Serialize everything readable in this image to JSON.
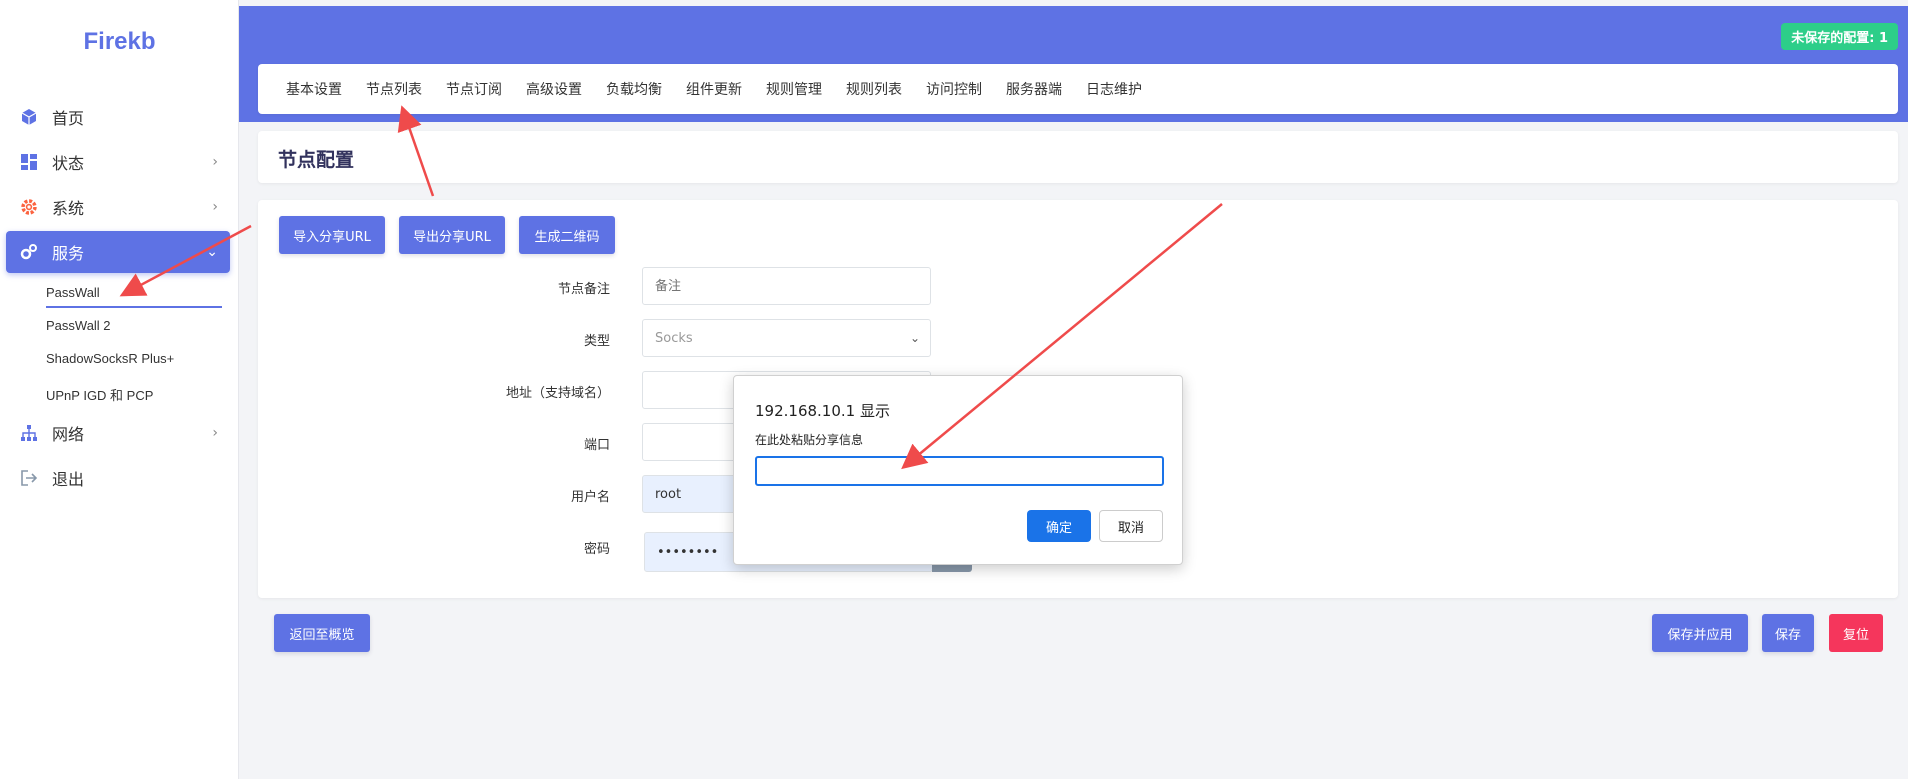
{
  "sidebar": {
    "logo": "Firekb",
    "items": [
      {
        "label": "首页",
        "icon": "cube-icon"
      },
      {
        "label": "状态",
        "icon": "dashboard-icon"
      },
      {
        "label": "系统",
        "icon": "gear-icon"
      },
      {
        "label": "服务",
        "icon": "services-gears-icon"
      },
      {
        "label": "网络",
        "icon": "network-icon"
      },
      {
        "label": "退出",
        "icon": "logout-icon"
      }
    ],
    "sub_items": [
      "PassWall",
      "PassWall 2",
      "ShadowSocksR Plus+",
      "UPnP IGD 和 PCP"
    ]
  },
  "header": {
    "unsaved_badge": "未保存的配置: 1",
    "tabs": [
      "基本设置",
      "节点列表",
      "节点订阅",
      "高级设置",
      "负载均衡",
      "组件更新",
      "规则管理",
      "规则列表",
      "访问控制",
      "服务器端",
      "日志维护"
    ]
  },
  "page": {
    "title": "节点配置"
  },
  "form": {
    "buttons": {
      "import": "导入分享URL",
      "export": "导出分享URL",
      "qrcode": "生成二维码"
    },
    "fields": [
      {
        "label": "节点备注",
        "value": "",
        "placeholder": "备注"
      },
      {
        "label": "类型",
        "value": "Socks"
      },
      {
        "label": "地址（支持域名）",
        "value": ""
      },
      {
        "label": "端口",
        "value": ""
      },
      {
        "label": "用户名",
        "value": "root"
      },
      {
        "label": "密码",
        "value": "••••••••"
      }
    ]
  },
  "footer": {
    "back": "返回至概览",
    "save_apply": "保存并应用",
    "save": "保存",
    "reset": "复位"
  },
  "dialog": {
    "title": "192.168.10.1 显示",
    "message": "在此处粘贴分享信息",
    "input_value": "",
    "ok": "确定",
    "cancel": "取消"
  },
  "colors": {
    "primary": "#5e72e4",
    "success": "#2dce89",
    "danger": "#f5365c",
    "annotation_arrow": "#ef4b4b",
    "dialog_blue": "#1a73e8"
  }
}
